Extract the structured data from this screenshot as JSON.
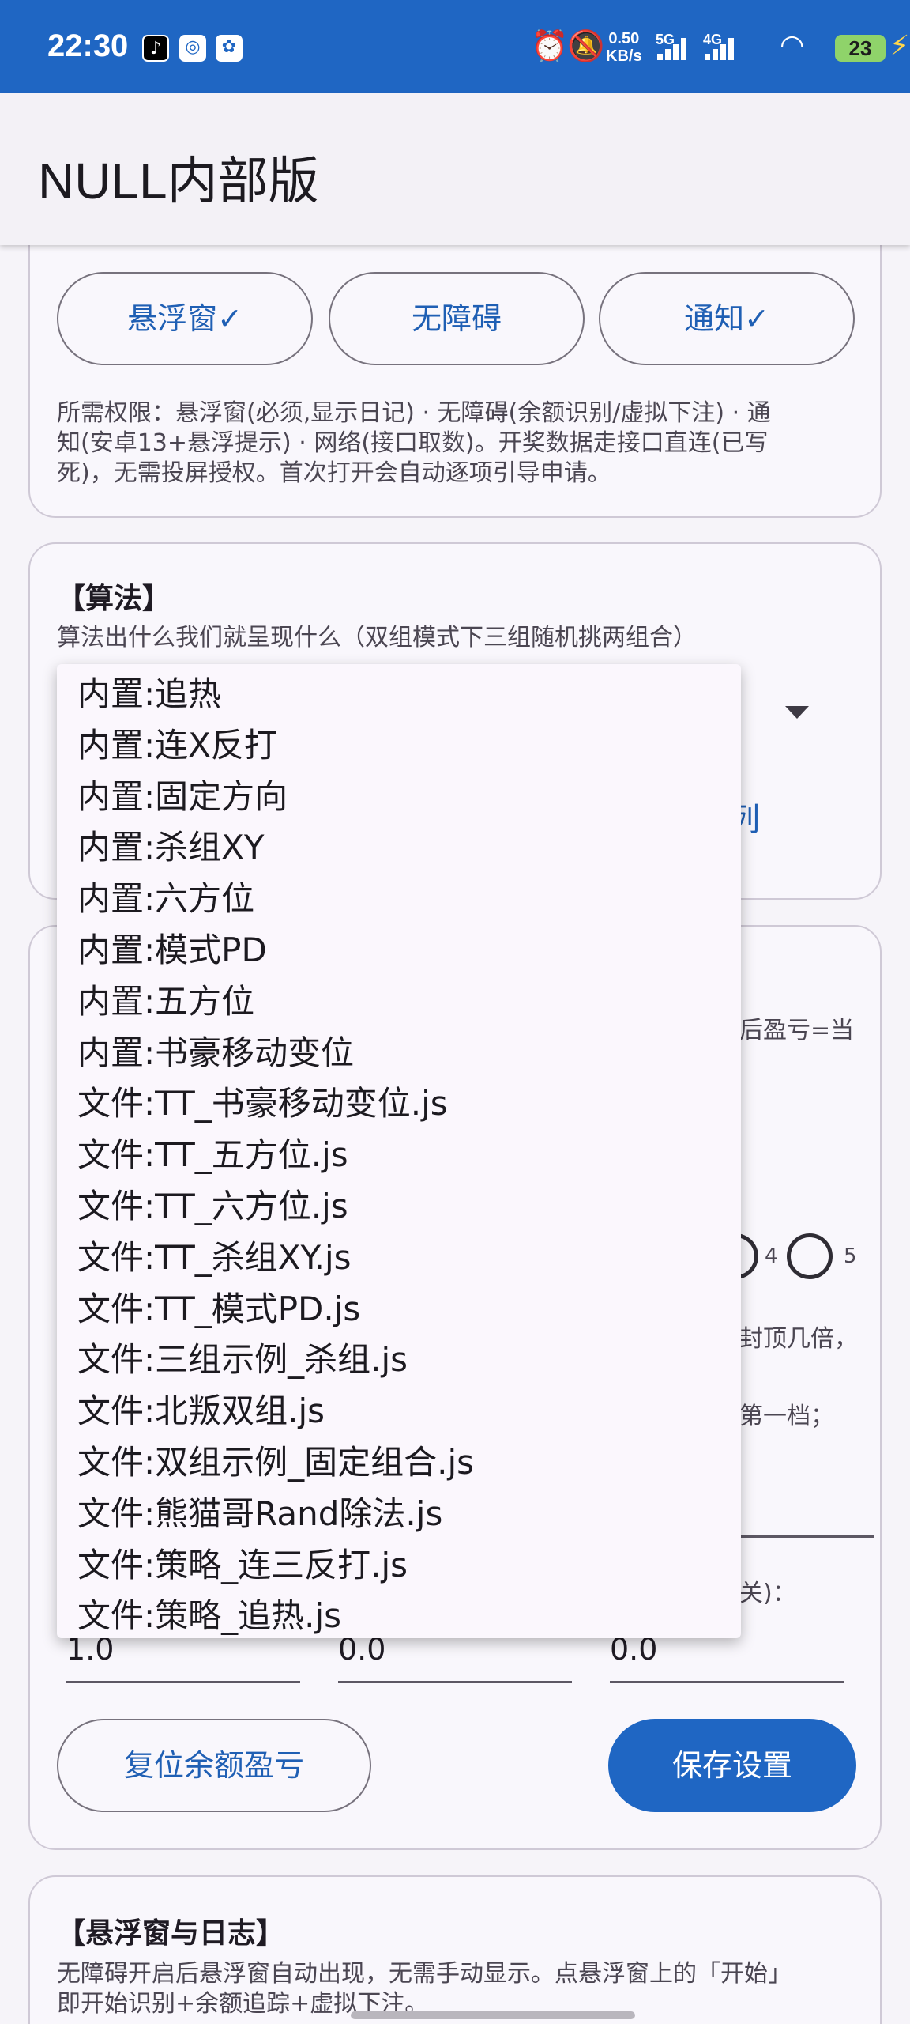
{
  "status_bar": {
    "time": "22:30",
    "speed_value": "0.50",
    "speed_unit": "KB/s",
    "net1": "5G",
    "net2": "4G",
    "battery": "23"
  },
  "app_bar": {
    "title": "NULL内部版"
  },
  "permissions": {
    "buttons": [
      {
        "label": "悬浮窗✓"
      },
      {
        "label": "无障碍"
      },
      {
        "label": "通知✓"
      }
    ],
    "description_lines": [
      "所需权限：悬浮窗(必须,显示日记) · 无障碍(余额识别/虚拟下注) · 通",
      "知(安卓13+悬浮提示) · 网络(接口取数)。开奖数据走接口直连(已写",
      "死)，无需投屏授权。首次打开会自动逐项引导申请。"
    ]
  },
  "algorithm": {
    "title": "【算法】",
    "subtitle": "算法出什么我们就呈现什么（双组模式下三组随机挑两组合）",
    "partial_link": "列"
  },
  "settings": {
    "fragment_profit": "后盈亏=当",
    "fragment_radio_1": "4",
    "fragment_radio_2": "5",
    "fragment_cap": "封顶几倍，",
    "fragment_tier": "第一档；",
    "fragment_close": "关)：",
    "field_values": [
      "1.0",
      "0.0",
      "0.0"
    ],
    "reset_label": "复位余额盈亏",
    "save_label": "保存设置"
  },
  "floating_log": {
    "title": "【悬浮窗与日志】",
    "description_lines": [
      "无障碍开启后悬浮窗自动出现，无需手动显示。点悬浮窗上的「开始」",
      "即开始识别+余额追踪+虚拟下注。"
    ]
  },
  "dropdown_menu": {
    "items": [
      "内置:追热",
      "内置:连X反打",
      "内置:固定方向",
      "内置:杀组XY",
      "内置:六方位",
      "内置:模式PD",
      "内置:五方位",
      "内置:书豪移动变位",
      "文件:TT_书豪移动变位.js",
      "文件:TT_五方位.js",
      "文件:TT_六方位.js",
      "文件:TT_杀组XY.js",
      "文件:TT_模式PD.js",
      "文件:三组示例_杀组.js",
      "文件:北叛双组.js",
      "文件:双组示例_固定组合.js",
      "文件:熊猫哥Rand除法.js",
      "文件:策略_连三反打.js",
      "文件:策略_追热.js"
    ]
  }
}
